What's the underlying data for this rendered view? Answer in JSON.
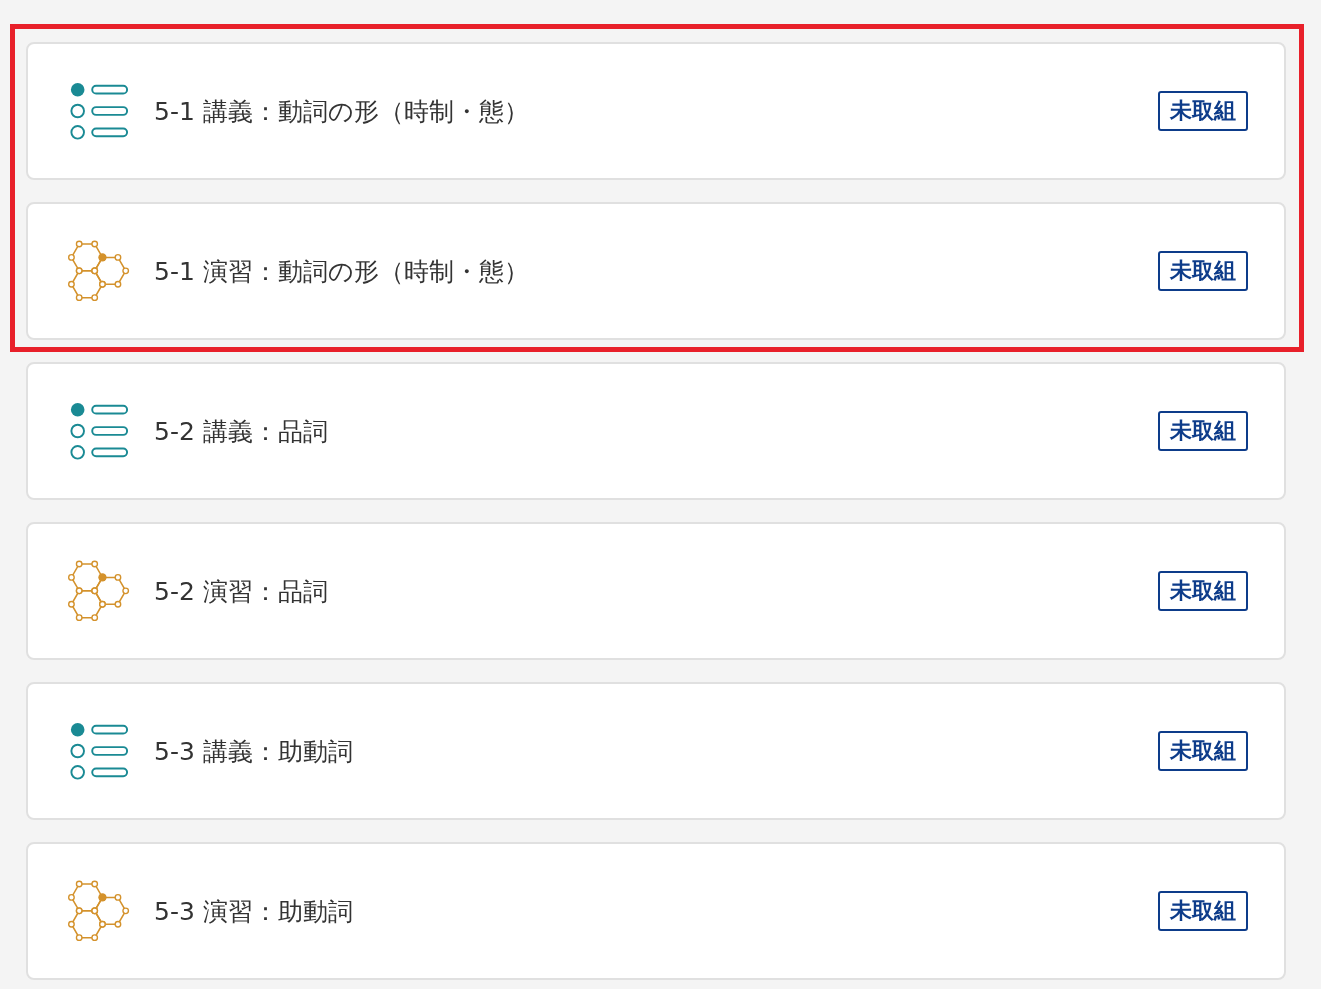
{
  "groups": [
    {
      "highlighted": true,
      "items": [
        {
          "kind": "lecture",
          "title": "5-1 講義：動詞の形（時制・態）",
          "status": "未取組"
        },
        {
          "kind": "exercise",
          "title": "5-1 演習：動詞の形（時制・態）",
          "status": "未取組"
        }
      ]
    },
    {
      "highlighted": false,
      "items": [
        {
          "kind": "lecture",
          "title": "5-2 講義：品詞",
          "status": "未取組"
        },
        {
          "kind": "exercise",
          "title": "5-2 演習：品詞",
          "status": "未取組"
        },
        {
          "kind": "lecture",
          "title": "5-3 講義：助動詞",
          "status": "未取組"
        },
        {
          "kind": "exercise",
          "title": "5-3 演習：助動詞",
          "status": "未取組"
        }
      ]
    }
  ]
}
